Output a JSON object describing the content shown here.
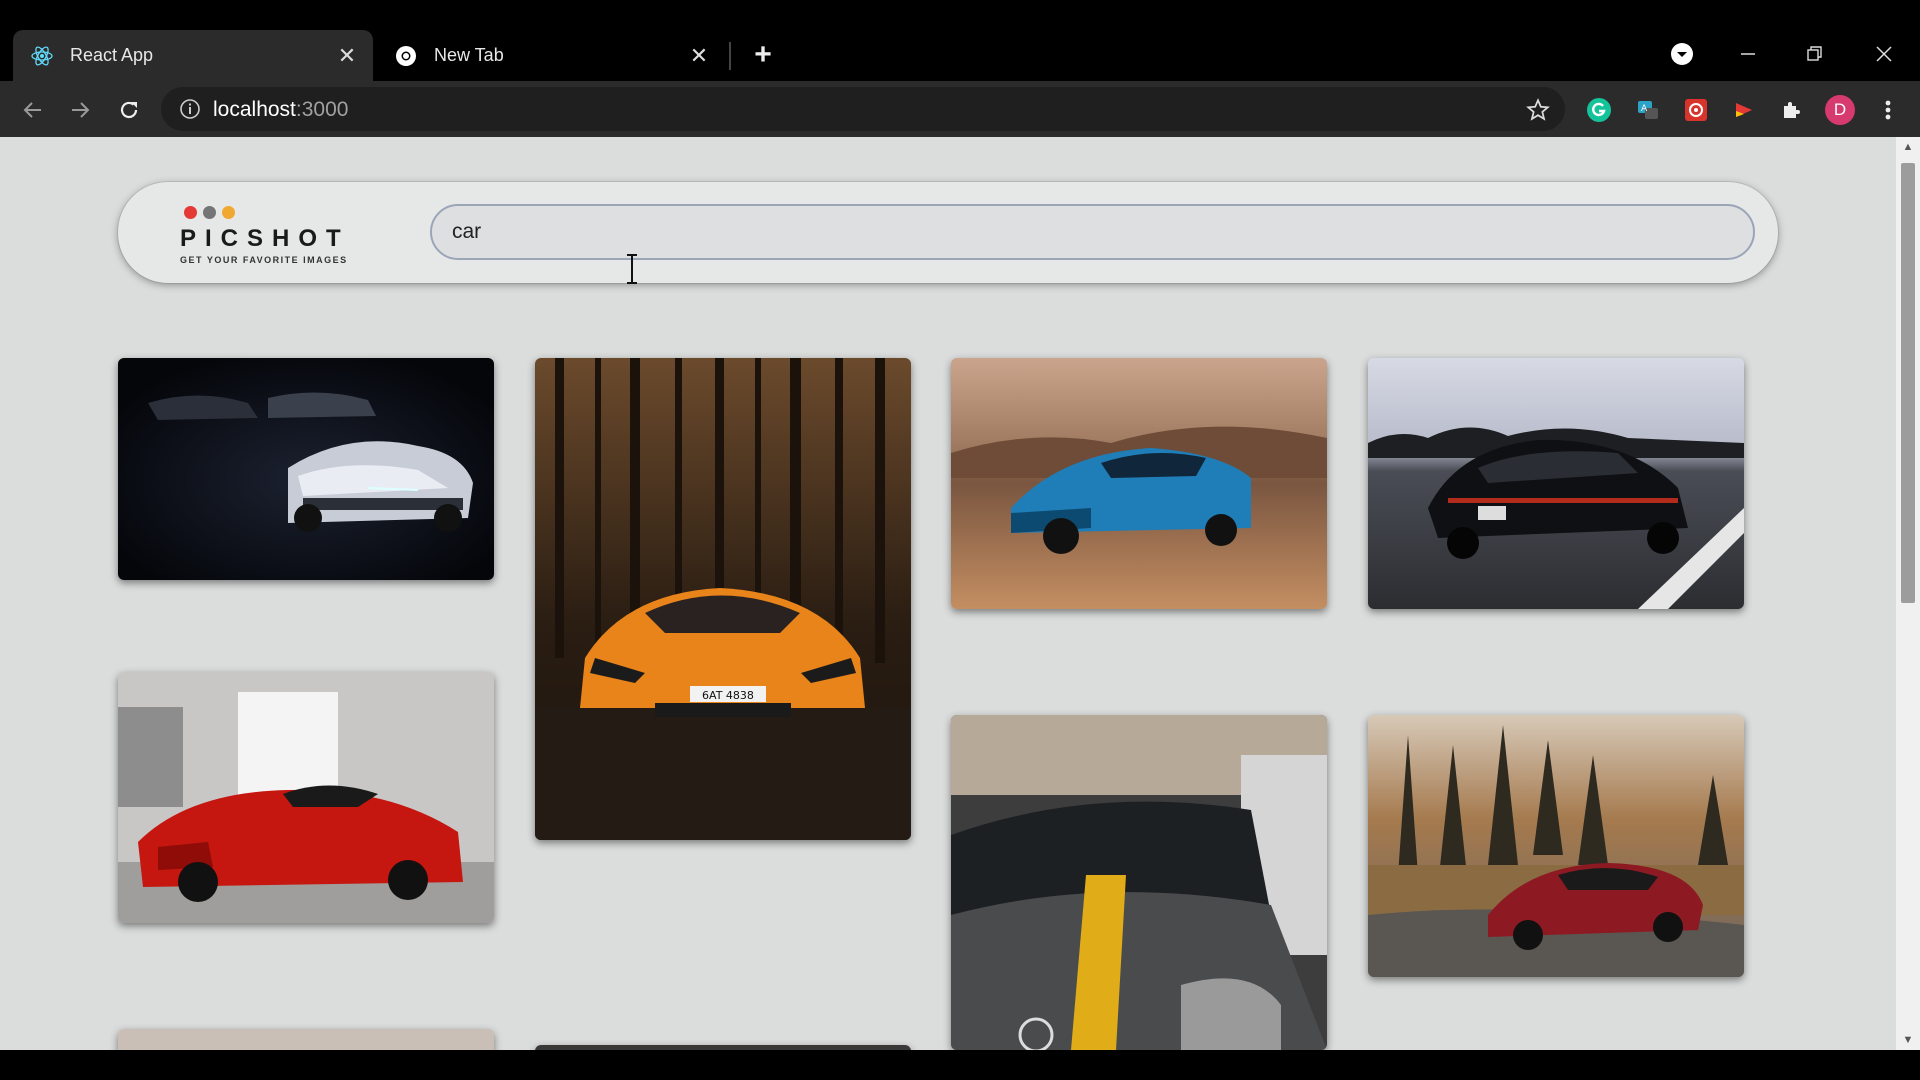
{
  "browser": {
    "tabs": [
      {
        "title": "React App",
        "icon": "react-icon",
        "active": true
      },
      {
        "title": "New Tab",
        "icon": "chrome-icon",
        "active": false
      }
    ],
    "url_host": "localhost",
    "url_port": ":3000",
    "profile_initial": "D",
    "extensions": [
      "grammarly-icon",
      "translate-icon",
      "puzzle-app-icon",
      "red-play-icon",
      "extensions-puzzle-icon"
    ]
  },
  "app": {
    "brand": "PICSHOT",
    "tagline": "GET YOUR FAVORITE IMAGES",
    "logo_dot_colors": [
      "#e53935",
      "#757575",
      "#f0a830"
    ],
    "search": {
      "value": "car",
      "placeholder": ""
    }
  },
  "gallery": {
    "photos": [
      {
        "subject": "white sports car in dark garage"
      },
      {
        "subject": "orange supercar in forest"
      },
      {
        "subject": "blue muscle car in desert"
      },
      {
        "subject": "black sedan on highway"
      },
      {
        "subject": "red supercar in showroom"
      },
      {
        "subject": "grey car with yellow stripe"
      },
      {
        "subject": "red coupe by pine trees"
      },
      {
        "subject": "beige image partially visible"
      },
      {
        "subject": "dark image partially visible"
      }
    ]
  }
}
